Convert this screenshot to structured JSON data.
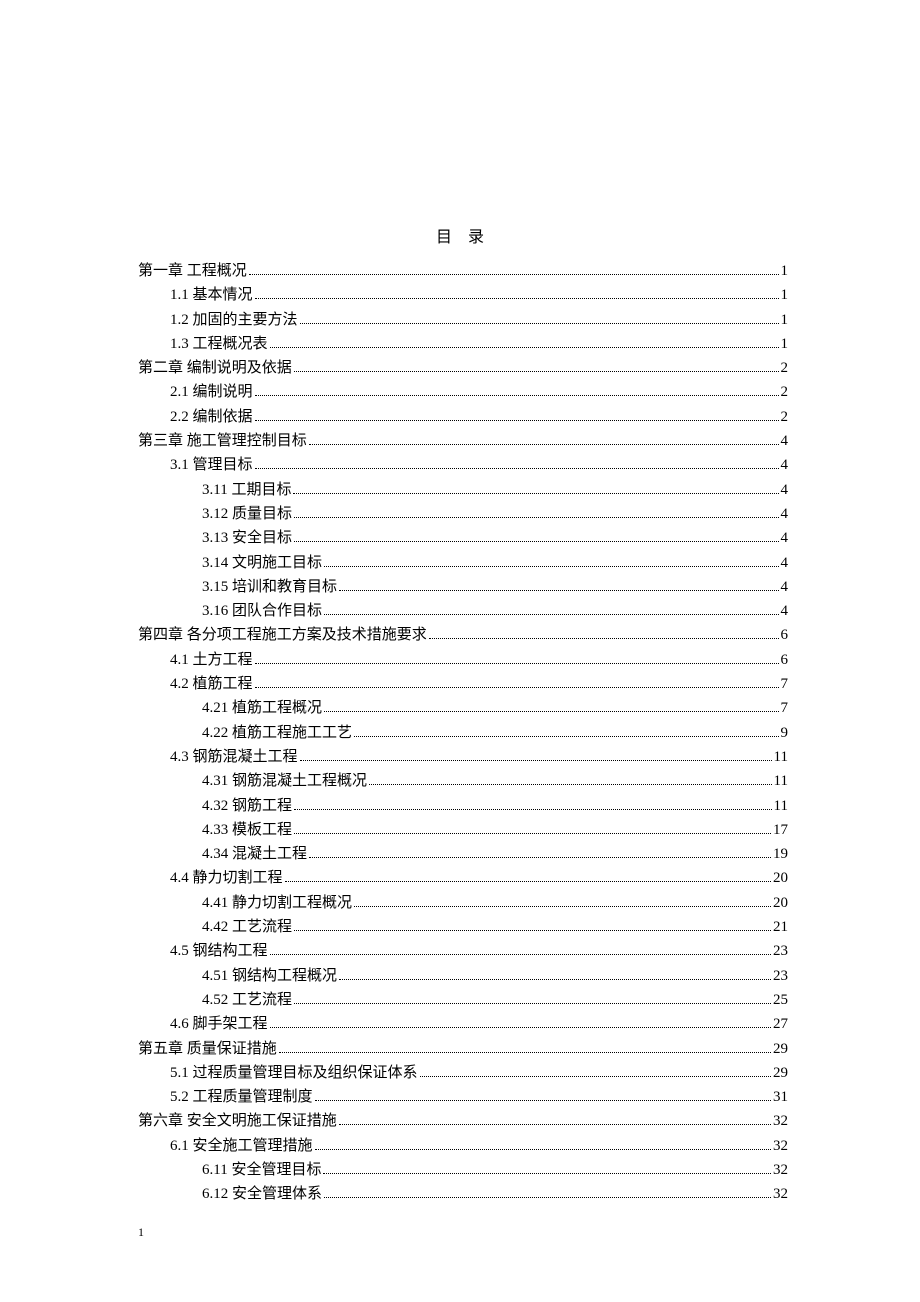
{
  "title": "目 录",
  "footer": "1",
  "toc": [
    {
      "level": 1,
      "label": "第一章 工程概况",
      "page": "1"
    },
    {
      "level": 2,
      "label": "1.1 基本情况",
      "page": "1"
    },
    {
      "level": 2,
      "label": "1.2 加固的主要方法",
      "page": "1"
    },
    {
      "level": 2,
      "label": "1.3 工程概况表",
      "page": "1"
    },
    {
      "level": 1,
      "label": "第二章 编制说明及依据",
      "page": "2"
    },
    {
      "level": 2,
      "label": "2.1 编制说明",
      "page": "2"
    },
    {
      "level": 2,
      "label": "2.2 编制依据",
      "page": "2"
    },
    {
      "level": 1,
      "label": "第三章 施工管理控制目标",
      "page": "4"
    },
    {
      "level": 2,
      "label": "3.1 管理目标",
      "page": "4"
    },
    {
      "level": 3,
      "label": "3.11 工期目标",
      "page": "4"
    },
    {
      "level": 3,
      "label": "3.12 质量目标",
      "page": "4"
    },
    {
      "level": 3,
      "label": "3.13 安全目标",
      "page": "4"
    },
    {
      "level": 3,
      "label": "3.14 文明施工目标",
      "page": "4"
    },
    {
      "level": 3,
      "label": "3.15 培训和教育目标",
      "page": "4"
    },
    {
      "level": 3,
      "label": "3.16 团队合作目标",
      "page": "4"
    },
    {
      "level": 1,
      "label": "第四章 各分项工程施工方案及技术措施要求",
      "page": "6"
    },
    {
      "level": 2,
      "label": "4.1 土方工程",
      "page": "6"
    },
    {
      "level": 2,
      "label": "4.2 植筋工程",
      "page": "7"
    },
    {
      "level": 3,
      "label": "4.21 植筋工程概况",
      "page": "7"
    },
    {
      "level": 3,
      "label": "4.22 植筋工程施工工艺",
      "page": "9"
    },
    {
      "level": 2,
      "label": "4.3 钢筋混凝土工程",
      "page": "11"
    },
    {
      "level": 3,
      "label": "4.31 钢筋混凝土工程概况",
      "page": "11"
    },
    {
      "level": 3,
      "label": "4.32 钢筋工程",
      "page": "11"
    },
    {
      "level": 3,
      "label": "4.33 模板工程",
      "page": "17"
    },
    {
      "level": 3,
      "label": "4.34 混凝土工程",
      "page": "19"
    },
    {
      "level": 2,
      "label": "4.4 静力切割工程",
      "page": "20"
    },
    {
      "level": 3,
      "label": "4.41 静力切割工程概况",
      "page": "20"
    },
    {
      "level": 3,
      "label": "4.42 工艺流程",
      "page": "21"
    },
    {
      "level": 2,
      "label": "4.5 钢结构工程",
      "page": "23"
    },
    {
      "level": 3,
      "label": "4.51 钢结构工程概况",
      "page": "23"
    },
    {
      "level": 3,
      "label": "4.52 工艺流程",
      "page": "25"
    },
    {
      "level": 2,
      "label": "4.6 脚手架工程",
      "page": "27"
    },
    {
      "level": 1,
      "label": "第五章 质量保证措施",
      "page": "29"
    },
    {
      "level": 2,
      "label": "5.1 过程质量管理目标及组织保证体系",
      "page": "29"
    },
    {
      "level": 2,
      "label": "5.2 工程质量管理制度",
      "page": "31"
    },
    {
      "level": 1,
      "label": "第六章 安全文明施工保证措施",
      "page": "32"
    },
    {
      "level": 2,
      "label": "6.1 安全施工管理措施",
      "page": "32"
    },
    {
      "level": 3,
      "label": "6.11 安全管理目标",
      "page": "32"
    },
    {
      "level": 3,
      "label": "6.12 安全管理体系",
      "page": "32"
    }
  ]
}
